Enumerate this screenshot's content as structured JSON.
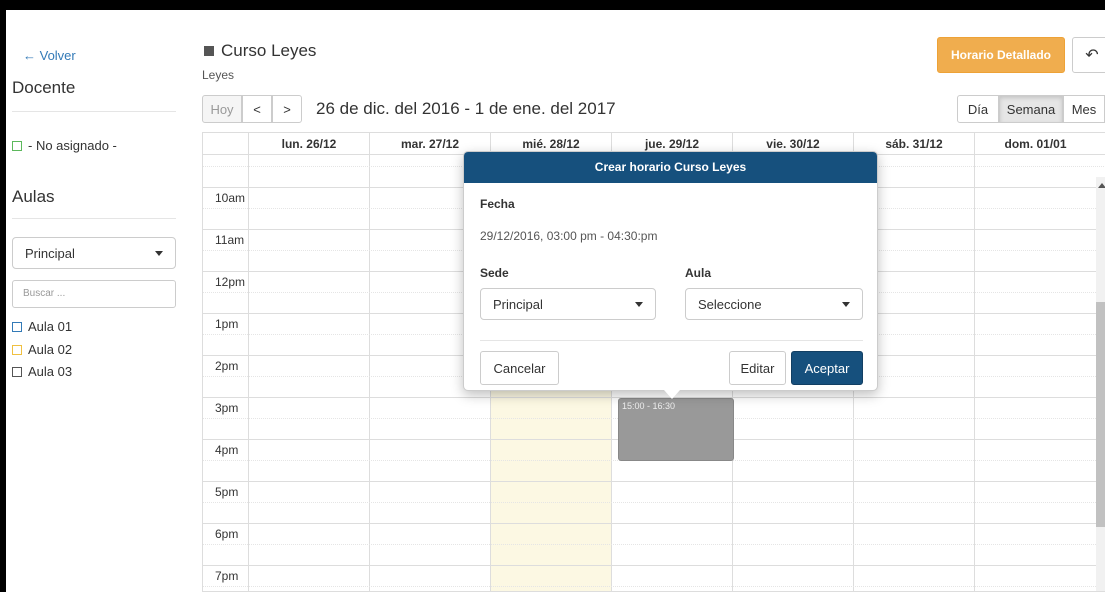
{
  "sidebar": {
    "back_label": "← Volver",
    "docente_title": "Docente",
    "docente_item": "- No asignado -",
    "aulas_title": "Aulas",
    "sede_select": "Principal",
    "search_placeholder": "Buscar ...",
    "aulas": [
      {
        "label": "Aula 01",
        "color": "#337ab7"
      },
      {
        "label": "Aula 02",
        "color": "#f0c040"
      },
      {
        "label": "Aula 03",
        "color": "#555555"
      }
    ]
  },
  "header": {
    "title": "Curso Leyes",
    "subtitle": "Leyes",
    "detail_button": "Horario Detallado",
    "undo_icon": "↶"
  },
  "toolbar": {
    "today": "Hoy",
    "prev": "<",
    "next": ">",
    "range": "26 de dic. del 2016 - 1 de ene. del 2017",
    "views": [
      "Día",
      "Semana",
      "Mes"
    ],
    "active_view": "Semana"
  },
  "calendar": {
    "days": [
      "lun. 26/12",
      "mar. 27/12",
      "mié. 28/12",
      "jue. 29/12",
      "vie. 30/12",
      "sáb. 31/12",
      "dom. 01/01"
    ],
    "today_index": 2,
    "hours": [
      "10am",
      "11am",
      "12pm",
      "1pm",
      "2pm",
      "3pm",
      "4pm",
      "5pm",
      "6pm",
      "7pm"
    ],
    "event_label": "15:00 - 16:30"
  },
  "popover": {
    "title": "Crear horario Curso Leyes",
    "fecha_label": "Fecha",
    "fecha_value": "29/12/2016, 03:00 pm - 04:30:pm",
    "sede_label": "Sede",
    "sede_value": "Principal",
    "aula_label": "Aula",
    "aula_value": "Seleccione",
    "cancel": "Cancelar",
    "edit": "Editar",
    "accept": "Aceptar"
  },
  "colors": {
    "accent": "#16507d",
    "orange": "#f0ad4e",
    "today_bg": "#fcf8e3",
    "event_bg": "#999999"
  }
}
